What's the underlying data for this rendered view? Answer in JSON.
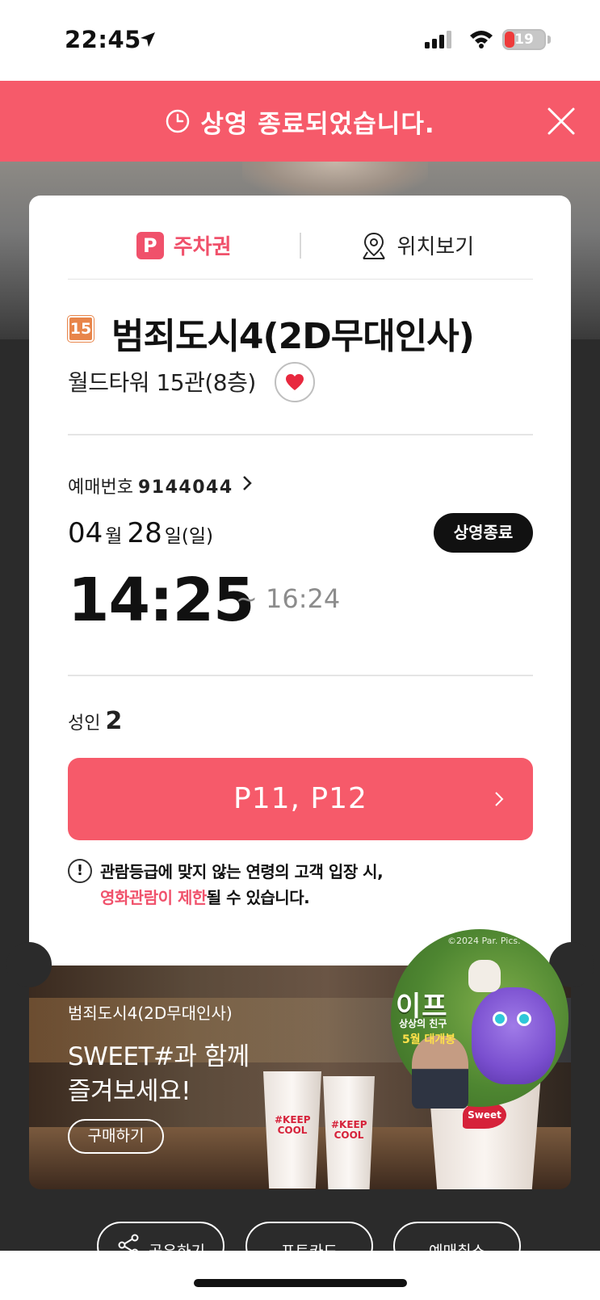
{
  "status_bar": {
    "time": "22:45",
    "battery": "19"
  },
  "banner": {
    "text": "상영 종료되었습니다."
  },
  "tabs": {
    "parking_icon": "P",
    "parking": "주차권",
    "location": "위치보기"
  },
  "movie": {
    "rating": "15",
    "title": "범죄도시4(2D무대인사)",
    "theater": "월드타워 15관(8층)"
  },
  "booking": {
    "label": "예매번호",
    "number": "9144044"
  },
  "date": {
    "month": "04",
    "month_unit": "월",
    "day": "28",
    "day_unit": "일",
    "weekday": "(일)"
  },
  "status_pill": "상영종료",
  "showtime": {
    "start": "14:25",
    "end": "~ 16:24"
  },
  "people": {
    "label": "성인",
    "count": "2"
  },
  "seats": "P11, P12",
  "notice": {
    "icon": "!",
    "line1": "관람등급에 맞지 않는 연령의 고객 입장 시,",
    "line2_red": "영화관람이 제한",
    "line2_rest": "될 수 있습니다."
  },
  "ad": {
    "subtitle": "범죄도시4(2D무대인사)",
    "headline1": "SWEET#과 함께",
    "headline2": "즐겨보세요!",
    "buy_button": "구매하기",
    "cup_logo": "#KEEP COOL",
    "bucket_logo": "Sweet",
    "promo_copyright": "©2024 Par. Pics.",
    "promo_title": "이프",
    "promo_subtitle": "상상의 친구",
    "promo_date": "5월 대개봉"
  },
  "actions": [
    "공유하기",
    "포토카드",
    "예매취소"
  ],
  "colors": {
    "accent": "#f65a6a",
    "rating_badge": "#e8854a",
    "background": "#2b2b2b"
  }
}
